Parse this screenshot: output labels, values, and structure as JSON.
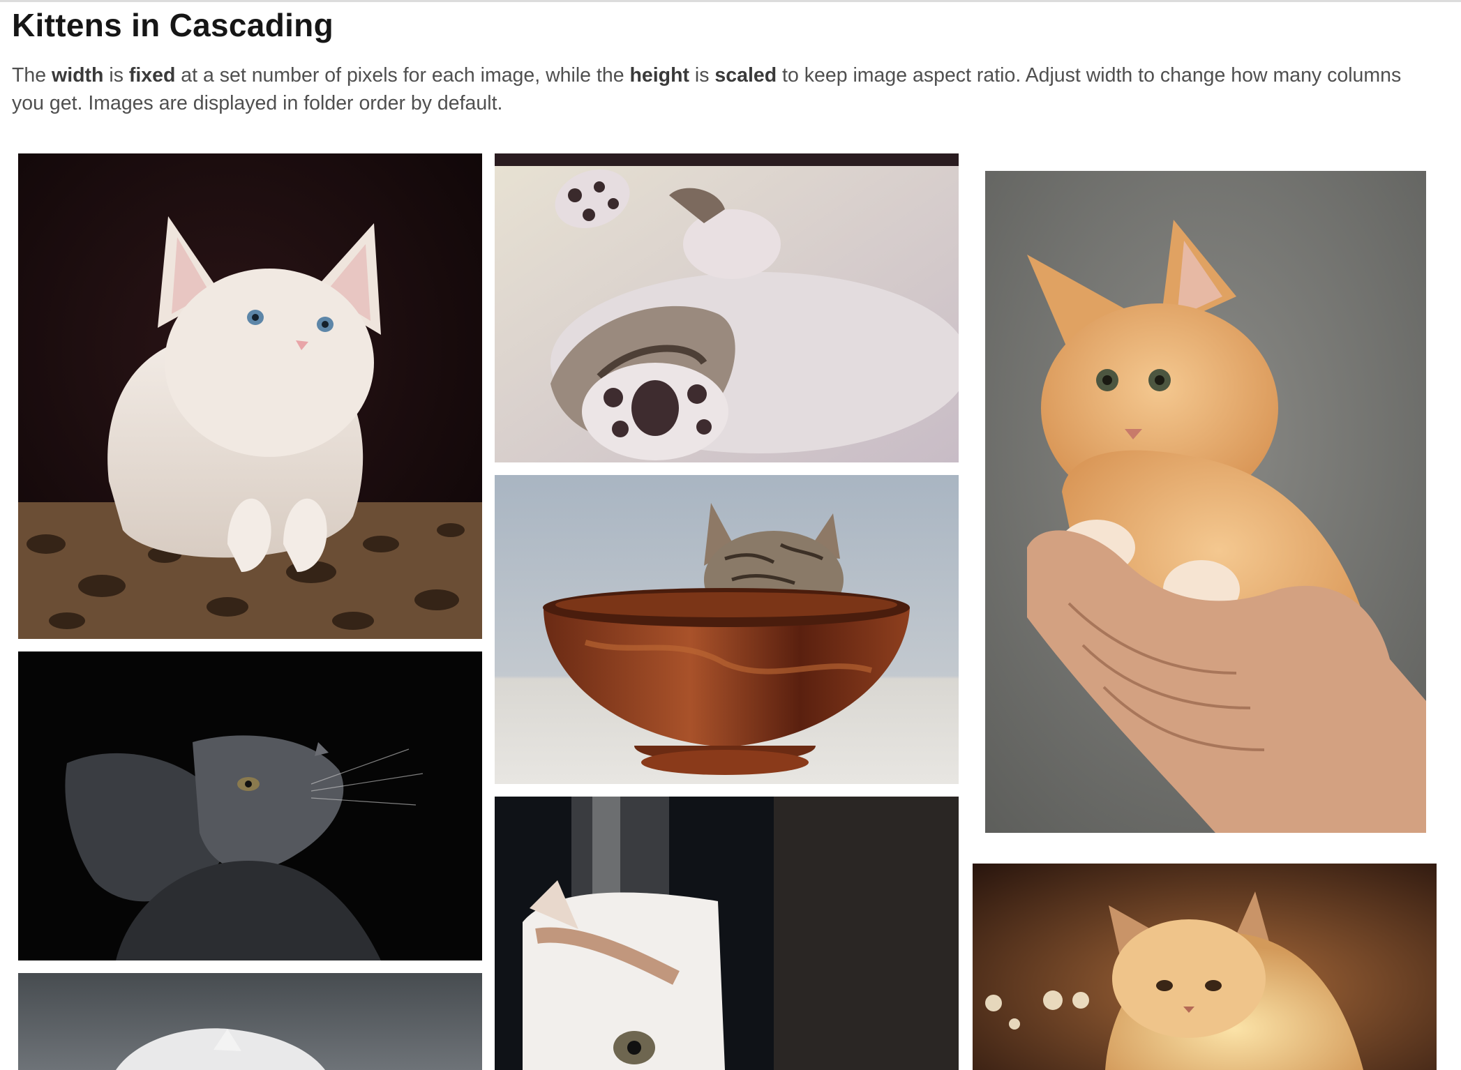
{
  "page": {
    "title": "Kittens in Cascading",
    "description": {
      "t1": "The ",
      "b1": "width",
      "t2": " is ",
      "b2": "fixed",
      "t3": " at a set number of pixels for each image, while the ",
      "b3": "height",
      "t4": " is ",
      "b4": "scaled",
      "t5": " to keep image aspect ratio. Adjust width to change how many columns you get. Images are displayed in folder order by default."
    }
  },
  "gallery": {
    "images": [
      {
        "name": "white kitten peeking over leopard print cushion",
        "column": 1
      },
      {
        "name": "kitten sleeping on back showing paws",
        "column": 2
      },
      {
        "name": "ginger kitten held in cupped hand",
        "column": 3
      },
      {
        "name": "gray kitten looking up on black background",
        "column": 1
      },
      {
        "name": "tabby kitten sleeping in wooden bowl",
        "column": 2
      },
      {
        "name": "white kitten peeking behind curtain",
        "column": 2
      },
      {
        "name": "white kitten against gray background",
        "column": 1
      },
      {
        "name": "kitten with warm lights bokeh",
        "column": 3
      }
    ]
  },
  "colors": {
    "heading": "#161616",
    "body_text": "#4f4f4f",
    "background": "#ffffff"
  }
}
